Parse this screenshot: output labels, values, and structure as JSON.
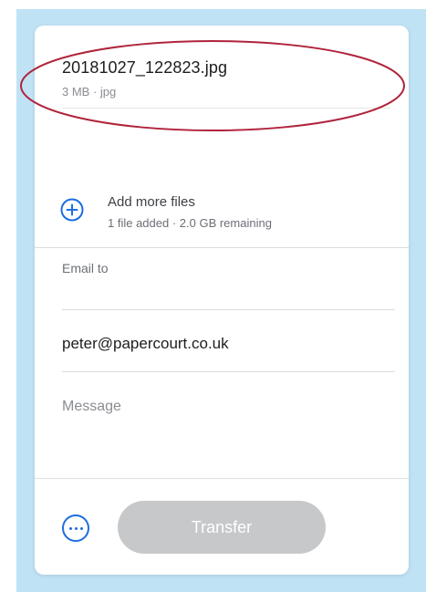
{
  "file": {
    "name": "20181027_122823.jpg",
    "meta": "3 MB · jpg"
  },
  "add_files": {
    "label": "Add more files",
    "status": "1 file added · 2.0 GB remaining",
    "icon": "plus-circle-icon"
  },
  "email_to": {
    "label": "Email to"
  },
  "recipient": {
    "value": "peter@papercourt.co.uk"
  },
  "message": {
    "placeholder": "Message"
  },
  "footer": {
    "options_icon": "ellipsis-circle-icon",
    "transfer_label": "Transfer"
  },
  "colors": {
    "accent": "#1e6de0",
    "annotation": "#b0243c",
    "background": "#bfe3f5",
    "button_disabled": "#c7c8ca"
  }
}
